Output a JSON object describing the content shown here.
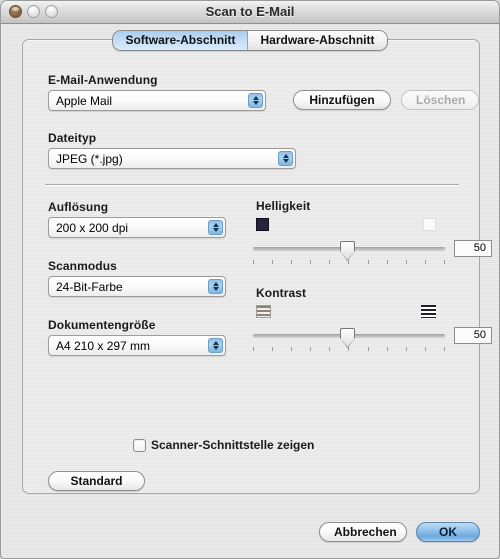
{
  "window": {
    "title": "Scan to E-Mail",
    "controls": {
      "close": "close-button",
      "minimize": "minimize-button",
      "zoom": "zoom-button"
    }
  },
  "tabs": [
    {
      "label": "Software-Abschnitt",
      "selected": true
    },
    {
      "label": "Hardware-Abschnitt",
      "selected": false
    }
  ],
  "form": {
    "email_app": {
      "label": "E-Mail-Anwendung",
      "value": "Apple Mail"
    },
    "add_button": "Hinzufügen",
    "delete_button": "Löschen",
    "file_type": {
      "label": "Dateityp",
      "value": "JPEG (*.jpg)"
    },
    "resolution": {
      "label": "Auflösung",
      "value": "200 x 200 dpi"
    },
    "scan_mode": {
      "label": "Scanmodus",
      "value": "24-Bit-Farbe"
    },
    "document_size": {
      "label": "Dokumentengröße",
      "value": "A4  210 x 297 mm"
    },
    "brightness": {
      "label": "Helligkeit",
      "value": "50",
      "percent": 50,
      "ticks": 11
    },
    "contrast": {
      "label": "Kontrast",
      "value": "50",
      "percent": 50,
      "ticks": 11
    },
    "show_scanner_interface": {
      "label": "Scanner-Schnittstelle zeigen",
      "checked": false
    },
    "standard_button": "Standard"
  },
  "footer": {
    "cancel_button": "Abbrechen",
    "ok_button": "OK"
  }
}
